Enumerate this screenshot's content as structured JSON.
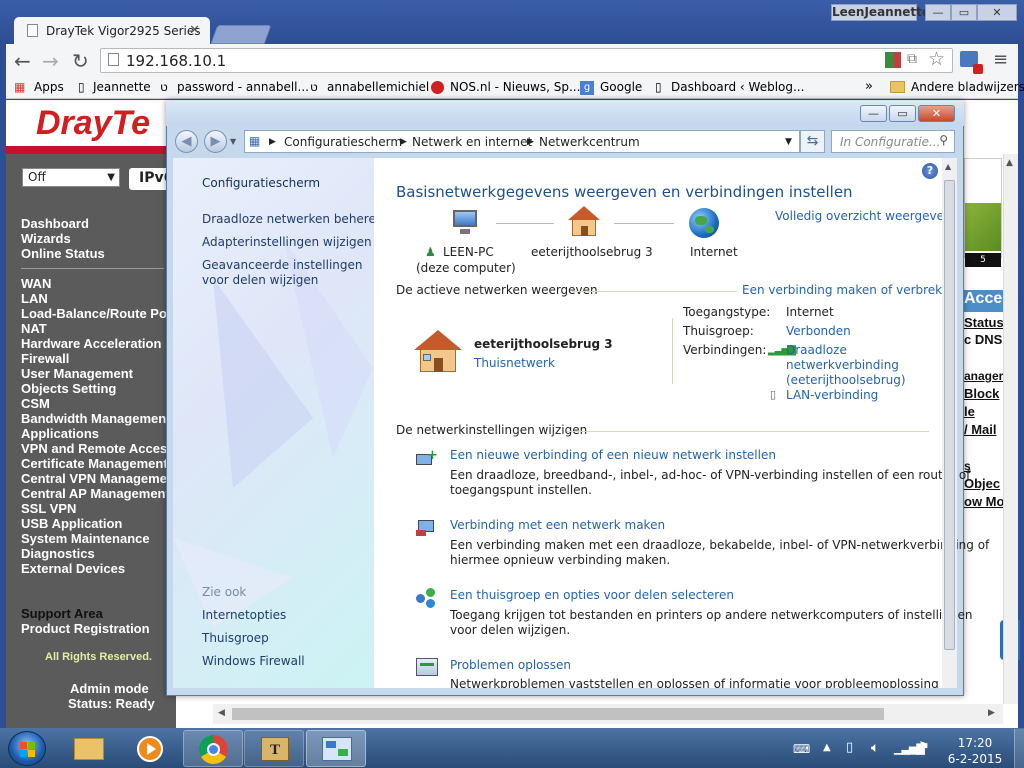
{
  "browser": {
    "tab_title": "DrayTek Vigor2925 Series",
    "user_name": "LeenJeannette",
    "url": "192.168.10.1",
    "bookmarks": [
      {
        "label": "Apps"
      },
      {
        "label": "Jeannette"
      },
      {
        "label": "password - annabell..."
      },
      {
        "label": "annabellemichiel"
      },
      {
        "label": "NOS.nl - Nieuws, Sp..."
      },
      {
        "label": "Google"
      },
      {
        "label": "Dashboard ‹ Weblog..."
      },
      {
        "label": "»"
      },
      {
        "label": "Andere bladwijzers"
      }
    ]
  },
  "draytek": {
    "select_value": "Off",
    "ipv6_label": "IPv6",
    "menu_group1": [
      "Dashboard",
      "Wizards",
      "Online Status"
    ],
    "menu_group2": [
      "WAN",
      "LAN",
      "Load-Balance/Route Policy",
      "NAT",
      "Hardware Acceleration",
      "Firewall",
      "User Management",
      "Objects Setting",
      "CSM",
      "Bandwidth Management",
      "Applications",
      "VPN and Remote Access",
      "Certificate Management",
      "Central VPN Management",
      "Central AP Management",
      "SSL VPN",
      "USB Application",
      "System Maintenance",
      "Diagnostics",
      "External Devices"
    ],
    "menu_group3": [
      "Support Area",
      "Product Registration"
    ],
    "rights": "All Rights Reserved.",
    "status_mode": "Admin mode",
    "status_ready": "Status: Ready",
    "right_fragments": [
      "Acces",
      "Status",
      "c DNS",
      "anager",
      "Block",
      "le",
      "/ Mail",
      "s",
      "Objec",
      "ow Mo"
    ],
    "right_number": "5"
  },
  "window": {
    "breadcrumb": [
      "Configuratiescherm",
      "Netwerk en internet",
      "Netwerkcentrum"
    ],
    "search_placeholder": "In Configuratie...",
    "sidebar": {
      "home": "Configuratiescherm",
      "links": [
        "Draadloze netwerken beheren",
        "Adapterinstellingen wijzigen",
        "Geavanceerde instellingen voor delen wijzigen"
      ],
      "see_also_title": "Zie ook",
      "see_also": [
        "Internetopties",
        "Thuisgroep",
        "Windows Firewall"
      ]
    },
    "main": {
      "title": "Basisnetwerkgegevens weergeven en verbindingen instellen",
      "full_overview": "Volledig overzicht weergeven",
      "map": {
        "pc_name": "LEEN-PC",
        "pc_sub": "(deze computer)",
        "network_name": "eeterijthoolsebrug  3",
        "internet": "Internet"
      },
      "active_header": "De actieve netwerken weergeven",
      "connect_link": "Een verbinding maken of verbreken",
      "active": {
        "name": "eeterijthoolsebrug  3",
        "type": "Thuisnetwerk",
        "access_label": "Toegangstype:",
        "access_value": "Internet",
        "homegroup_label": "Thuisgroep:",
        "homegroup_value": "Verbonden",
        "connections_label": "Verbindingen:",
        "wifi_line1": "Draadloze",
        "wifi_line2": "netwerkverbinding",
        "wifi_line3": "(eeterijthoolsebrug)",
        "lan": "LAN-verbinding"
      },
      "change_header": "De netwerkinstellingen wijzigen",
      "tasks": [
        {
          "title": "Een nieuwe verbinding of een nieuw netwerk instellen",
          "desc1": "Een draadloze, breedband-, inbel-, ad-hoc- of VPN-verbinding instellen of een router of",
          "desc2": "toegangspunt instellen."
        },
        {
          "title": "Verbinding met een netwerk maken",
          "desc1": "Een verbinding maken met een draadloze, bekabelde, inbel- of VPN-netwerkverbinding of",
          "desc2": "hiermee opnieuw verbinding maken."
        },
        {
          "title": "Een thuisgroep en opties voor delen selecteren",
          "desc1": "Toegang krijgen tot bestanden en printers op andere netwerkcomputers of instellingen",
          "desc2": "voor delen wijzigen."
        },
        {
          "title": "Problemen oplossen",
          "desc1": "Netwerkproblemen vaststellen en oplossen of informatie voor probleemoplossing zoeken.",
          "desc2": ""
        }
      ]
    }
  },
  "taskbar": {
    "time": "17:20",
    "date": "6-2-2015"
  },
  "colors": {
    "draytek_red": "#d11f1f",
    "link_blue": "#2463b0",
    "title_blue": "#1e4f8f",
    "dt_sidebar": "#5b5b5b"
  }
}
